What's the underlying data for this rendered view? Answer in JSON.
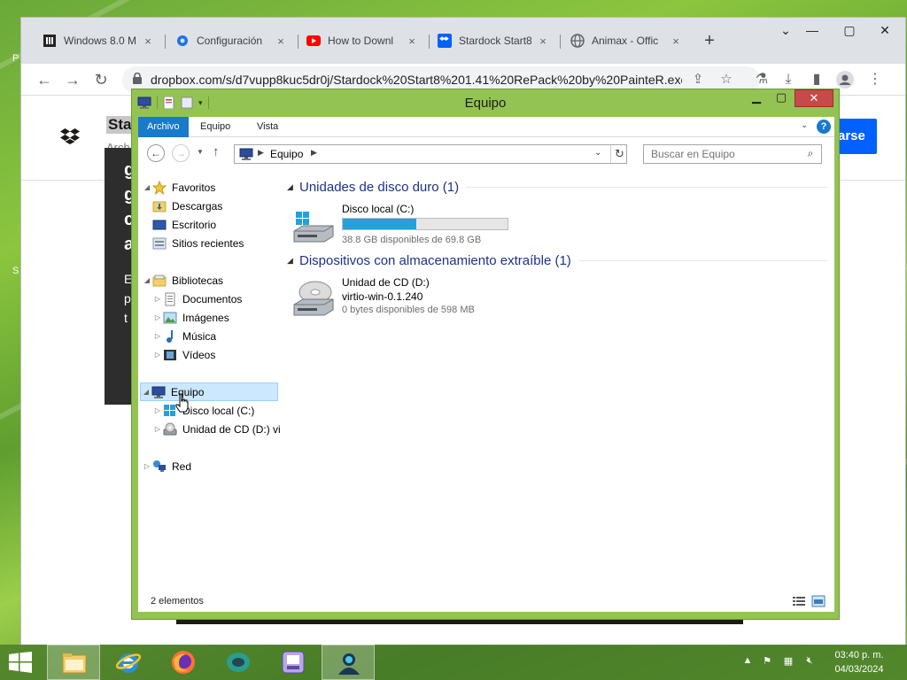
{
  "browser": {
    "tabs": [
      {
        "title": "Windows 8.0 M",
        "icon": "document-icon"
      },
      {
        "title": "Configuración",
        "icon": "gear-icon"
      },
      {
        "title": "How to Downl",
        "icon": "youtube-icon"
      },
      {
        "title": "Stardock Start8",
        "icon": "dropbox-icon"
      },
      {
        "title": "Animax - Offic",
        "icon": "globe-icon"
      }
    ],
    "close_glyph": "×",
    "new_tab": "+",
    "url": "dropbox.com/s/d7vupp8kuc5dr0j/Stardock%20Start8%201.41%20RePack%20by%20PainteR.exe..."
  },
  "page": {
    "title": "Sta",
    "subtitle": "Arch",
    "button": "arse",
    "dark_letters": [
      "g",
      "g",
      "c",
      "a"
    ],
    "side_letters": [
      "E",
      "p",
      "t"
    ],
    "left_letters": [
      "P",
      "S"
    ]
  },
  "explorer": {
    "title": "Equipo",
    "ribbon_tabs": [
      "Archivo",
      "Equipo",
      "Vista"
    ],
    "help": "?",
    "breadcrumb": "Equipo",
    "search_placeholder": "Buscar en Equipo",
    "nav": {
      "favorites": "Favoritos",
      "downloads": "Descargas",
      "desktop": "Escritorio",
      "recent": "Sitios recientes",
      "libraries": "Bibliotecas",
      "documents": "Documentos",
      "images": "Imágenes",
      "music": "Música",
      "videos": "Vídeos",
      "computer": "Equipo",
      "local_disk": "Disco local (C:)",
      "cd_drive": "Unidad de CD (D:) vi",
      "network": "Red"
    },
    "groups": {
      "hard_disks": "Unidades de disco duro (1)",
      "removable": "Dispositivos con almacenamiento extraíble (1)"
    },
    "drive_c": {
      "name": "Disco local (C:)",
      "space": "38.8 GB disponibles de 69.8 GB",
      "used_fraction": 0.444
    },
    "drive_d": {
      "name": "Unidad de CD (D:)",
      "label": "virtio-win-0.1.240",
      "space": "0 bytes disponibles de 598 MB"
    },
    "status": "2 elementos"
  },
  "taskbar": {
    "time": "03:40 p. m.",
    "date": "04/03/2024"
  },
  "colors": {
    "accent": "#1979ca",
    "window_frame": "#93c353",
    "progress": "#26a0da"
  }
}
